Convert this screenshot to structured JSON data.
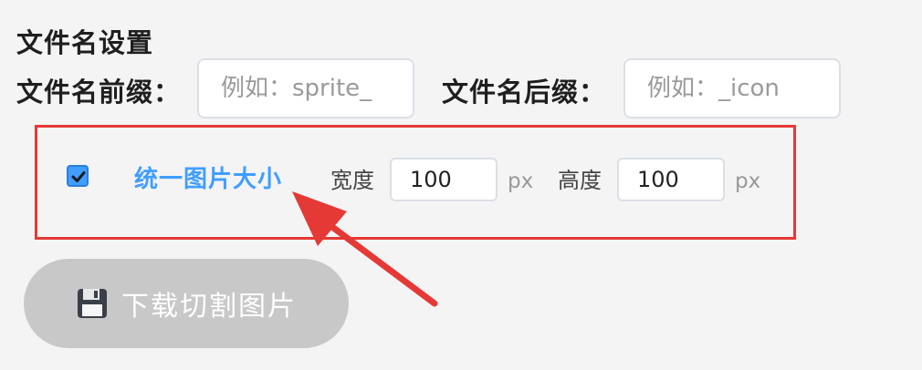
{
  "section": {
    "title": "文件名设置"
  },
  "prefix": {
    "label": "文件名前缀：",
    "placeholder": "例如：sprite_",
    "value": ""
  },
  "suffix": {
    "label": "文件名后缀：",
    "placeholder": "例如：_icon",
    "value": ""
  },
  "resize": {
    "checked": true,
    "label": "统一图片大小",
    "width_label": "宽度",
    "width_value": "100",
    "height_label": "高度",
    "height_value": "100",
    "unit": "px"
  },
  "download": {
    "label": "下载切割图片",
    "icon": "floppy-disk-icon"
  },
  "colors": {
    "accent": "#409eff",
    "highlight_border": "#e53935",
    "button_disabled": "#c8c8c8"
  }
}
